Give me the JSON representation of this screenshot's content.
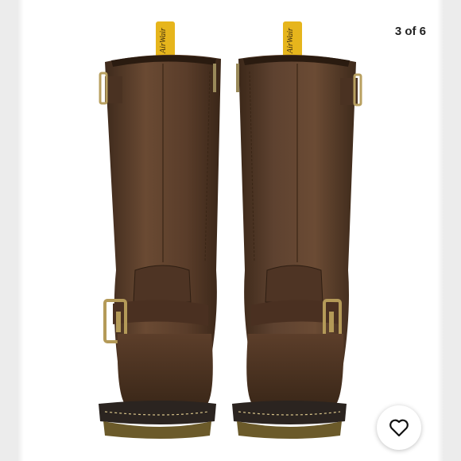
{
  "viewer": {
    "counter": "3 of 6",
    "image": {
      "subject": "product-photo",
      "brand_tag_text": "AirWair"
    },
    "like_button": {
      "icon": "heart-icon"
    }
  }
}
